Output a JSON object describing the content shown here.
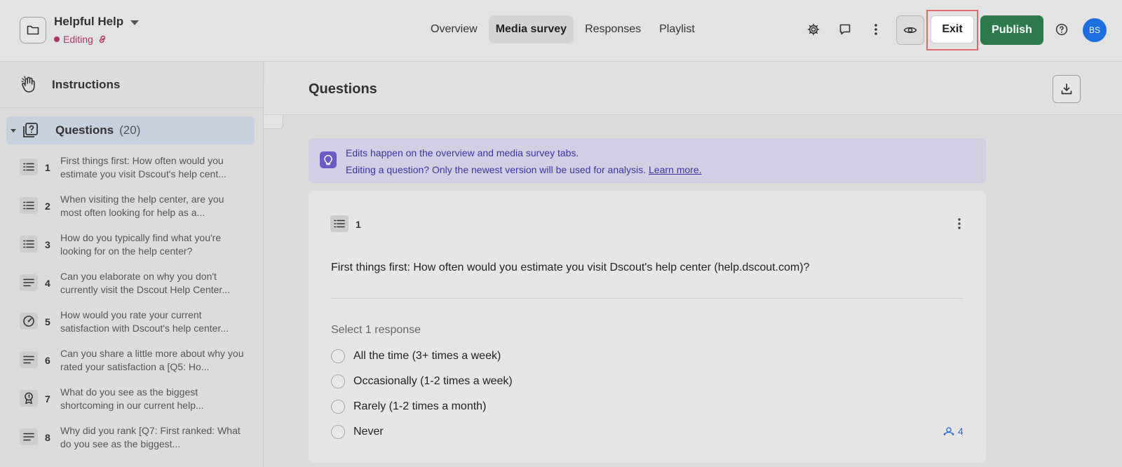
{
  "header": {
    "project_title": "Helpful Help",
    "status_label": "Editing",
    "nav_tabs": [
      "Overview",
      "Media survey",
      "Responses",
      "Playlist"
    ],
    "active_tab": "Media survey",
    "exit_label": "Exit",
    "publish_label": "Publish",
    "avatar_initials": "BS",
    "colors": {
      "publish": "#2d7a4b",
      "status": "#b0336b",
      "avatar": "#1d6fe0"
    }
  },
  "sidebar": {
    "instructions_label": "Instructions",
    "questions_label": "Questions",
    "questions_count": "(20)",
    "items": [
      {
        "num": "1",
        "type": "list-icon",
        "text": "First things first: How often would you estimate you visit Dscout's help cent..."
      },
      {
        "num": "2",
        "type": "list-icon",
        "text": "When visiting the help center, are you most often looking for help as a..."
      },
      {
        "num": "3",
        "type": "list-icon",
        "text": "How do you typically find what you're looking for on the help center?"
      },
      {
        "num": "4",
        "type": "text-lines-icon",
        "text": "Can you elaborate on why you don't currently visit the Dscout Help Center..."
      },
      {
        "num": "5",
        "type": "scale-gauge-icon",
        "text": "How would you rate your current satisfaction with Dscout's help center..."
      },
      {
        "num": "6",
        "type": "text-lines-icon",
        "text": "Can you share a little more about why you rated your satisfaction a [Q5: Ho..."
      },
      {
        "num": "7",
        "type": "ranking-ribbon-icon",
        "text": "What do you see as the biggest shortcoming in our current help..."
      },
      {
        "num": "8",
        "type": "text-lines-icon",
        "text": "Why did you rank [Q7: First ranked: What do you see as the biggest..."
      }
    ]
  },
  "main": {
    "title": "Questions",
    "banner": {
      "line1": "Edits happen on the overview and media survey tabs.",
      "line2": "Editing a question? Only the newest version will be used for analysis.",
      "link": "Learn more."
    },
    "card": {
      "number": "1",
      "question": "First things first: How often would you estimate you visit Dscout's help center (help.dscout.com)?",
      "select_hint": "Select 1 response",
      "options": [
        "All the time (3+ times a week)",
        "Occasionally (1-2 times a week)",
        "Rarely (1-2 times a month)",
        "Never"
      ],
      "response_count": "4"
    }
  }
}
